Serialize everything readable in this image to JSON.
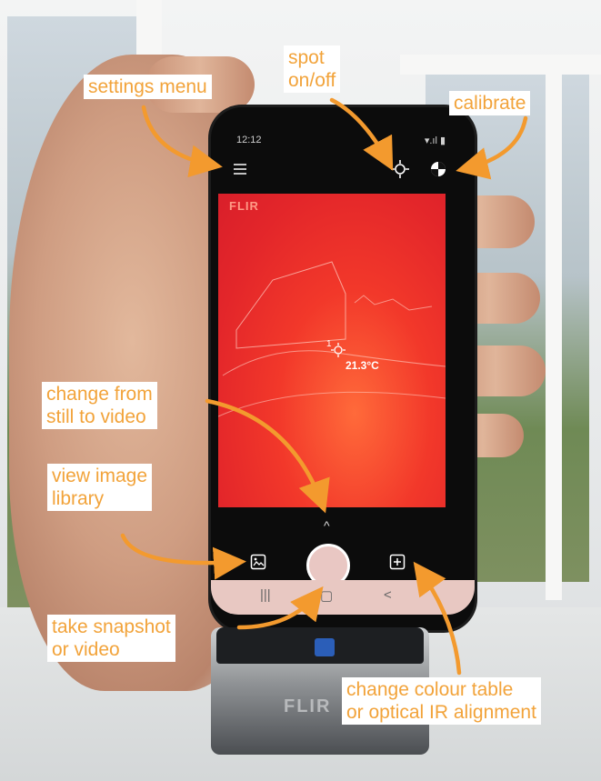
{
  "annotations": {
    "settings_menu": "settings menu",
    "spot_line1": "spot",
    "spot_line2": "on/off",
    "calibrate": "calibrate",
    "change_still_video_line1": "change from",
    "change_still_video_line2": "still to video",
    "view_library_line1": "view image",
    "view_library_line2": "library",
    "take_snapshot_line1": "take snapshot",
    "take_snapshot_line2": "or video",
    "colour_table_line1": "change colour table",
    "colour_table_line2": "or optical IR alignment"
  },
  "phone": {
    "status_time": "12:12",
    "status_icons": "▾.ıl ▮",
    "watermark": "FLIR",
    "spot_label": "1",
    "temperature": "21.3°C",
    "chevron": "^",
    "nav_recents": "|||",
    "nav_home": "▢",
    "nav_back": "<"
  },
  "module": {
    "logo": "FLIR"
  },
  "colors": {
    "annotation_text": "#f2a33a",
    "arrow": "#f39a2e",
    "thermal": "#e3262a"
  },
  "icons": [
    "menu-icon",
    "crosshair-icon",
    "calibrate-icon",
    "gallery-icon",
    "add-icon",
    "chevron-up-icon"
  ]
}
